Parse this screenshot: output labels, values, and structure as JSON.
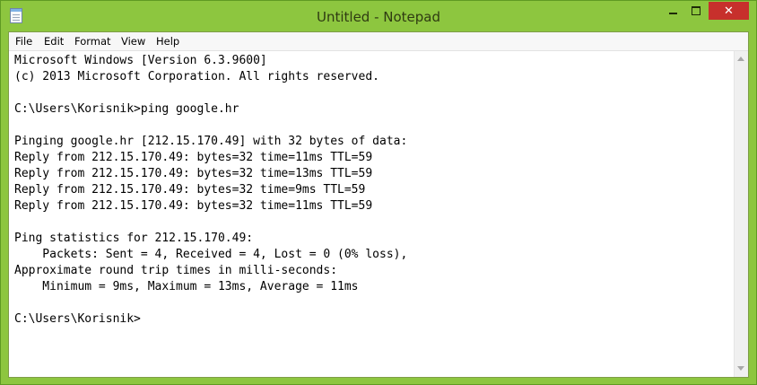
{
  "window": {
    "title": "Untitled - Notepad",
    "close_glyph": "✕",
    "accent_color": "#8dc63f"
  },
  "menu": {
    "items": [
      "File",
      "Edit",
      "Format",
      "View",
      "Help"
    ]
  },
  "document": {
    "lines": [
      "Microsoft Windows [Version 6.3.9600]",
      "(c) 2013 Microsoft Corporation. All rights reserved.",
      "",
      "C:\\Users\\Korisnik>ping google.hr",
      "",
      "Pinging google.hr [212.15.170.49] with 32 bytes of data:",
      "Reply from 212.15.170.49: bytes=32 time=11ms TTL=59",
      "Reply from 212.15.170.49: bytes=32 time=13ms TTL=59",
      "Reply from 212.15.170.49: bytes=32 time=9ms TTL=59",
      "Reply from 212.15.170.49: bytes=32 time=11ms TTL=59",
      "",
      "Ping statistics for 212.15.170.49:",
      "    Packets: Sent = 4, Received = 4, Lost = 0 (0% loss),",
      "Approximate round trip times in milli-seconds:",
      "    Minimum = 9ms, Maximum = 13ms, Average = 11ms",
      "",
      "C:\\Users\\Korisnik>"
    ]
  }
}
